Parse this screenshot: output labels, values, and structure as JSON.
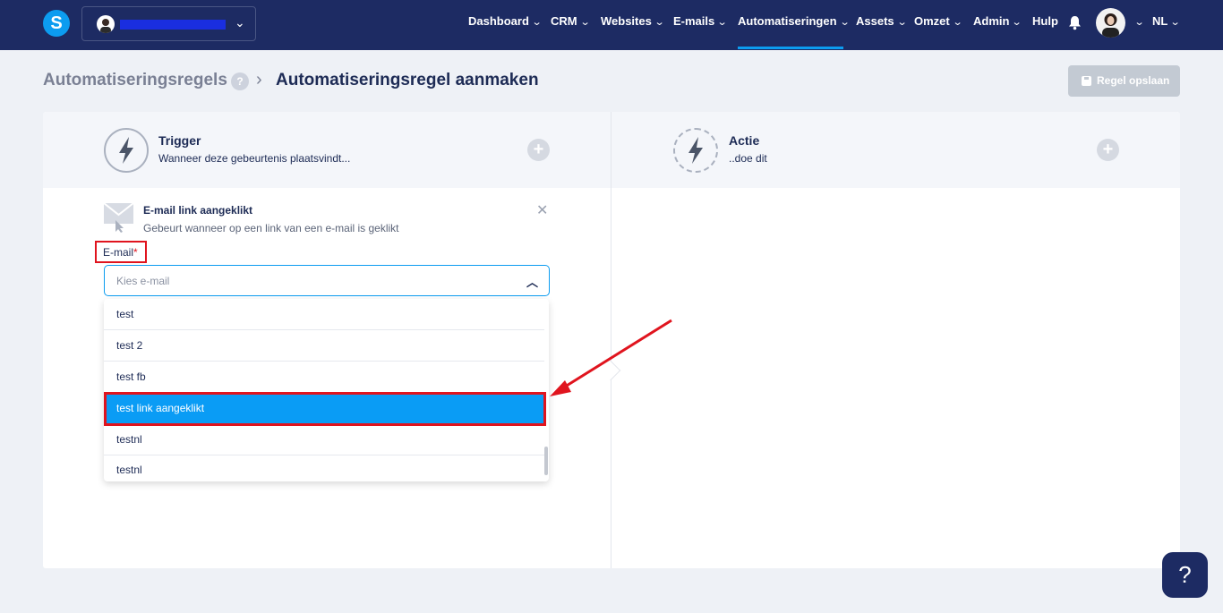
{
  "nav": {
    "logo_letter": "S",
    "items": [
      {
        "label": "Dashboard"
      },
      {
        "label": "CRM"
      },
      {
        "label": "Websites"
      },
      {
        "label": "E-mails"
      },
      {
        "label": "Automatiseringen"
      },
      {
        "label": "Assets"
      },
      {
        "label": "Omzet"
      },
      {
        "label": "Admin"
      },
      {
        "label": "Hulp"
      }
    ],
    "active_item": "Automatiseringen",
    "language": "NL"
  },
  "breadcrumb": {
    "parent": "Automatiseringsregels",
    "current": "Automatiseringsregel aanmaken"
  },
  "save_button": "Regel opslaan",
  "trigger": {
    "title": "Trigger",
    "subtitle": "Wanneer deze gebeurtenis plaatsvindt..."
  },
  "action": {
    "title": "Actie",
    "subtitle": "..doe dit"
  },
  "trigger_item": {
    "title": "E-mail link aangeklikt",
    "description": "Gebeurt wanneer op een link van een e-mail is geklikt"
  },
  "email_field": {
    "label": "E-mail",
    "required_mark": "*",
    "placeholder": "Kies e-mail",
    "options": [
      "test",
      "test 2",
      "test fb",
      "test link aangeklikt",
      "testnl",
      "testnl"
    ],
    "highlighted": "test link aangeklikt"
  },
  "colors": {
    "navbar": "#1d2b63",
    "accent": "#0c9cf0",
    "annotation_red": "#e0141e"
  },
  "help_fab": "?"
}
